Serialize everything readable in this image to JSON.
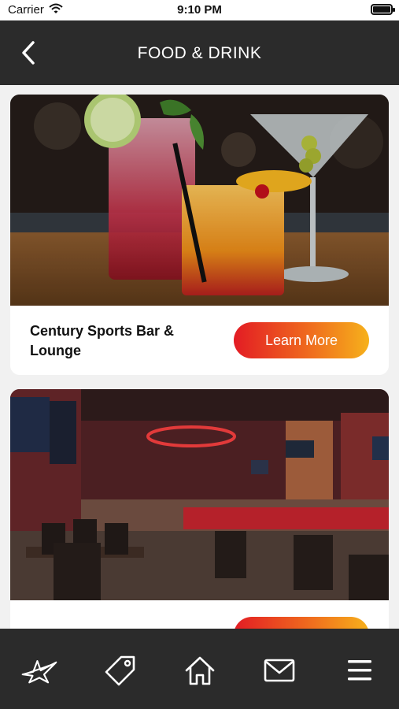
{
  "status_bar": {
    "carrier": "Carrier",
    "time": "9:10 PM"
  },
  "header": {
    "title": "FOOD & DRINK",
    "back_icon": "chevron-left-icon"
  },
  "venues": [
    {
      "name": "Century Sports Bar & Lounge",
      "button_label": "Learn More",
      "image": "cocktail-drinks-photo"
    },
    {
      "name": "",
      "button_label": "",
      "image": "bar-interior-photo"
    }
  ],
  "tab_bar": {
    "items": [
      {
        "icon": "star-logo-icon"
      },
      {
        "icon": "tag-icon"
      },
      {
        "icon": "home-icon"
      },
      {
        "icon": "mail-icon"
      },
      {
        "icon": "menu-icon"
      }
    ]
  },
  "colors": {
    "header_bg": "#2b2b2b",
    "button_gradient_start": "#e31c24",
    "button_gradient_end": "#f6b11b"
  }
}
